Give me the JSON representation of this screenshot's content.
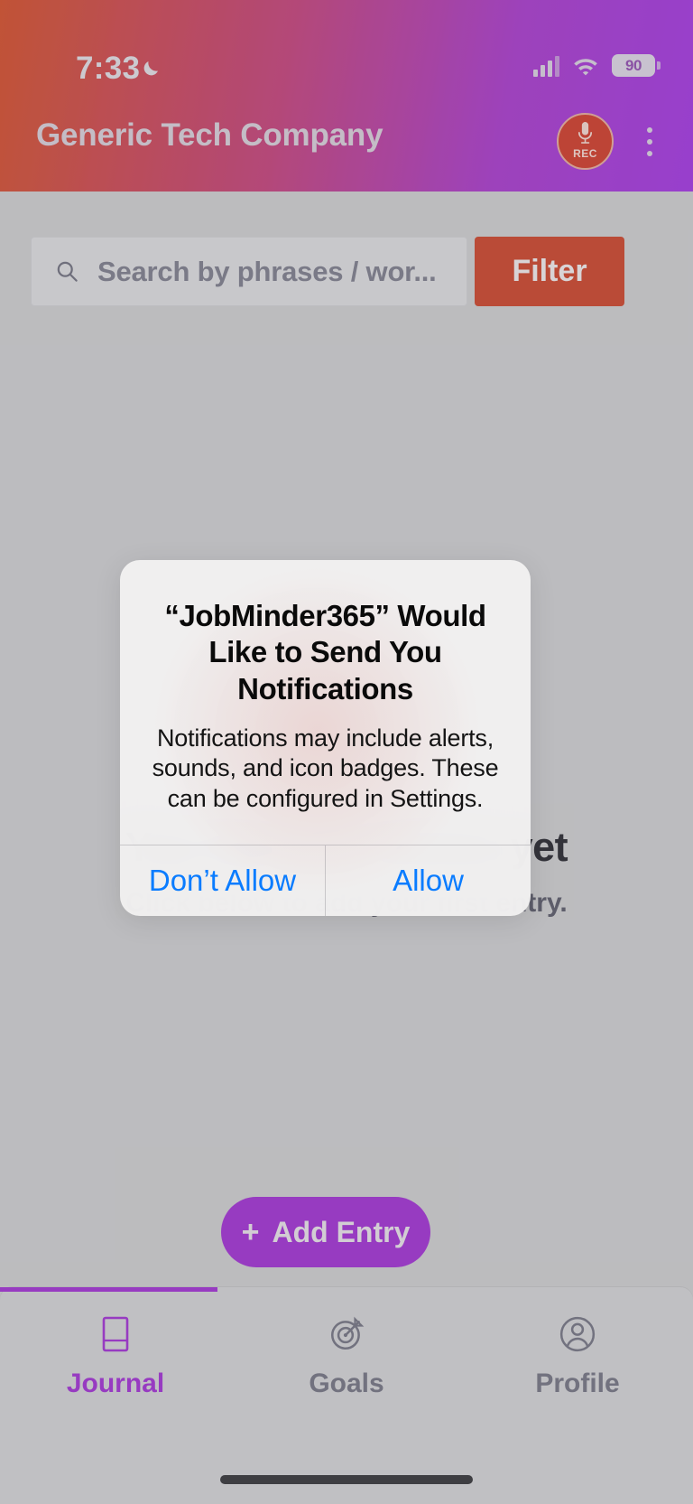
{
  "status_bar": {
    "time": "7:33",
    "moon_icon": "crescent-moon-icon",
    "signal_icon": "cellular-signal-icon",
    "wifi_icon": "wifi-icon",
    "battery_level": "90"
  },
  "header": {
    "title": "Generic Tech Company",
    "record_button_label": "REC",
    "mic_icon": "microphone-icon",
    "overflow_icon": "kebab-menu-icon",
    "gradient_start": "#c8502f",
    "gradient_end": "#9b3ad4"
  },
  "search": {
    "placeholder": "Search by phrases / wor...",
    "icon": "search-icon",
    "filter_label": "Filter",
    "filter_color": "#c2472f"
  },
  "empty_state": {
    "title": "You have no entries yet",
    "subtitle": "Click below to add your first entry."
  },
  "add_entry": {
    "plus": "+",
    "label": "Add Entry",
    "color": "#9b35c9"
  },
  "tabbar": {
    "active_color": "#9b35c9",
    "inactive_color": "#72727f",
    "items": [
      {
        "label": "Journal",
        "icon": "book-icon",
        "active": true
      },
      {
        "label": "Goals",
        "icon": "target-icon",
        "active": false
      },
      {
        "label": "Profile",
        "icon": "person-circle-icon",
        "active": false
      }
    ]
  },
  "alert": {
    "title": "“JobMinder365” Would Like to Send You Notifications",
    "message": "Notifications may include alerts, sounds, and icon badges. These can be configured in Settings.",
    "deny_label": "Don’t Allow",
    "allow_label": "Allow",
    "action_color": "#0a7cff"
  }
}
